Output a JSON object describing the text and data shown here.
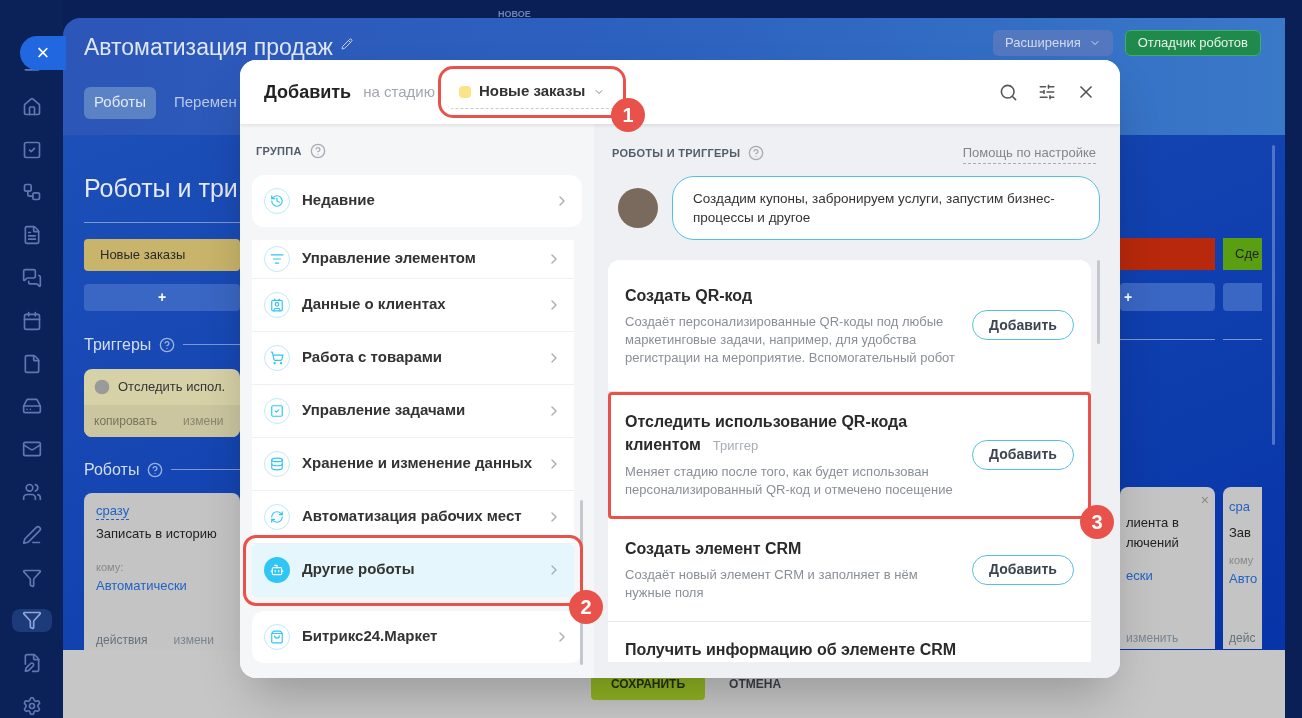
{
  "nav_items": [
    {
      "selected": false
    },
    {
      "selected": false
    },
    {
      "selected": false
    },
    {
      "selected": false
    },
    {
      "selected": false
    },
    {
      "selected": false
    },
    {
      "selected": false
    },
    {
      "selected": false
    },
    {
      "selected": false
    },
    {
      "selected": false
    },
    {
      "selected": false
    },
    {
      "selected": false
    },
    {
      "selected": false
    },
    {
      "selected": true
    },
    {
      "selected": false
    },
    {
      "selected": false
    }
  ],
  "close_symbol": "×",
  "badge_new": "НОВОЕ",
  "header": {
    "title": "Автоматизация продаж",
    "tabs": [
      {
        "label": "Роботы",
        "selected": true
      },
      {
        "label": "Перемен",
        "selected": false
      }
    ],
    "extensions_button": "Расширения",
    "debugger_button": "Отладчик роботов"
  },
  "board": {
    "heading": "Роботы и три",
    "left": {
      "stage": {
        "name": "Новые заказы",
        "color": "#c8b46a"
      },
      "add": "+",
      "triggers_label": "Триггеры",
      "trigger": {
        "title": "Отследить испол.",
        "copy": "копировать",
        "edit": "измени"
      },
      "robots_label": "Роботы",
      "robot": {
        "delay": "сразу",
        "title": "Записать в историю",
        "to_label": "кому:",
        "to_value": "Автоматически",
        "actions": "действия",
        "edit": "измени"
      }
    },
    "right": [
      {
        "stage": {
          "color": "#b8280c"
        },
        "add": "+",
        "card": {
          "close": "×",
          "lines": [
            "лиента в",
            "лючений"
          ],
          "to_value": "ески",
          "edit": "изменить"
        }
      },
      {
        "stage": {
          "name": "Сде",
          "color": "#5a9f12"
        },
        "card": {
          "delay": "сра",
          "lines": [
            "Зав"
          ],
          "to_label": "кому",
          "to_value": "Авто",
          "actions": "дейс"
        }
      }
    ]
  },
  "footer": {
    "save": "СОХРАНИТЬ",
    "cancel": "ОТМЕНА"
  },
  "dialog": {
    "title": "Добавить",
    "stage_prefix": "на стадию",
    "stage": {
      "name": "Новые заказы",
      "color": "#fbe38a",
      "highlighted": true
    },
    "group_header": "ГРУППА",
    "groups": [
      {
        "kind": "pinned",
        "label": "Недавние",
        "selected": false,
        "highlighted": false
      },
      {
        "kind": "group",
        "label": "Управление элементом",
        "selected": false,
        "highlighted": false
      },
      {
        "kind": "group",
        "label": "Данные о клиентах",
        "selected": false,
        "highlighted": false
      },
      {
        "kind": "group",
        "label": "Работа с товарами",
        "selected": false,
        "highlighted": false
      },
      {
        "kind": "group",
        "label": "Управление задачами",
        "selected": false,
        "highlighted": false
      },
      {
        "kind": "group",
        "label": "Хранение и изменение данных",
        "selected": false,
        "highlighted": false
      },
      {
        "kind": "group",
        "label": "Автоматизация рабочих мест",
        "selected": false,
        "highlighted": false
      },
      {
        "kind": "group",
        "label": "Другие роботы",
        "selected": true,
        "highlighted": true
      },
      {
        "kind": "footer",
        "label": "Битрикс24.Маркет",
        "selected": false,
        "highlighted": false
      }
    ],
    "list_header": "РОБОТЫ И ТРИГГЕРЫ",
    "help_link": "Помощь по настройке",
    "hint": "Создадим купоны, забронируем услуги, запустим бизнес-процессы и другое",
    "items": [
      {
        "title": "Создать QR-код",
        "highlighted": false,
        "description": "Создаёт персонализированные QR-коды под любые маркетинговые задачи, например, для удобства регистрации на мероприятие. Вспомогательный робот",
        "button": "Добавить"
      },
      {
        "title": "Отследить использование QR-кода клиентом",
        "highlighted": true,
        "tag": "Триггер",
        "description": "Меняет стадию после того, как будет использован персонализированный QR-код и отмечено посещение",
        "button": "Добавить"
      },
      {
        "title": "Создать элемент CRM",
        "highlighted": false,
        "description": "Создаёт новый элемент CRM и заполняет в нём нужные поля",
        "button": "Добавить"
      },
      {
        "title": "Получить информацию об элементе CRM",
        "highlighted": false
      }
    ]
  },
  "callouts": [
    {
      "number": "1"
    },
    {
      "number": "2"
    },
    {
      "number": "3"
    }
  ]
}
